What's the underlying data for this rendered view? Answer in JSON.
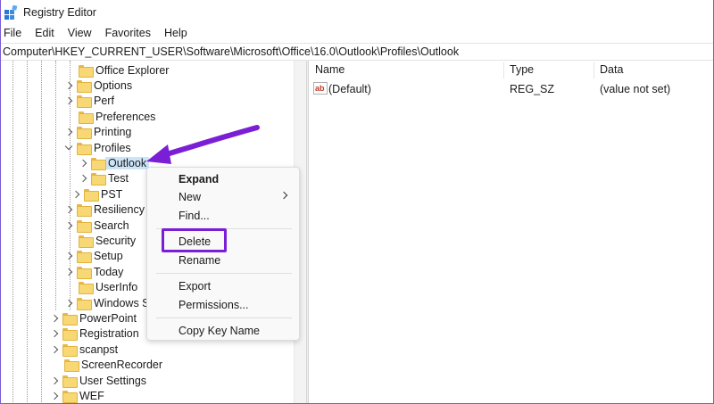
{
  "window": {
    "title": "Registry Editor"
  },
  "menu": [
    "File",
    "Edit",
    "View",
    "Favorites",
    "Help"
  ],
  "address": "Computer\\HKEY_CURRENT_USER\\Software\\Microsoft\\Office\\16.0\\Outlook\\Profiles\\Outlook",
  "tree": {
    "rows": [
      {
        "label": "Office Explorer",
        "expander": "none"
      },
      {
        "label": "Options",
        "expander": "collapsed"
      },
      {
        "label": "Perf",
        "expander": "collapsed"
      },
      {
        "label": "Preferences",
        "expander": "none"
      },
      {
        "label": "Printing",
        "expander": "collapsed"
      },
      {
        "label": "Profiles",
        "expander": "expanded"
      },
      {
        "label": "Outlook",
        "expander": "collapsed",
        "selected": true
      },
      {
        "label": "Test",
        "expander": "collapsed"
      },
      {
        "label": "PST",
        "expander": "collapsed"
      },
      {
        "label": "Resiliency",
        "expander": "collapsed"
      },
      {
        "label": "Search",
        "expander": "collapsed"
      },
      {
        "label": "Security",
        "expander": "none"
      },
      {
        "label": "Setup",
        "expander": "collapsed"
      },
      {
        "label": "Today",
        "expander": "collapsed"
      },
      {
        "label": "UserInfo",
        "expander": "none"
      },
      {
        "label": "Windows S",
        "expander": "collapsed"
      },
      {
        "label": "PowerPoint",
        "expander": "collapsed"
      },
      {
        "label": "Registration",
        "expander": "collapsed"
      },
      {
        "label": "scanpst",
        "expander": "collapsed"
      },
      {
        "label": "ScreenRecorder",
        "expander": "none"
      },
      {
        "label": "User Settings",
        "expander": "collapsed"
      },
      {
        "label": "WEF",
        "expander": "collapsed"
      }
    ]
  },
  "list": {
    "columns": [
      "Name",
      "Type",
      "Data"
    ],
    "rows": [
      {
        "name": "(Default)",
        "type": "REG_SZ",
        "data": "(value not set)",
        "icon": "string-value-icon"
      }
    ]
  },
  "context_menu": {
    "items": [
      "Expand",
      "New",
      "Find...",
      "Delete",
      "Rename",
      "Export",
      "Permissions...",
      "Copy Key Name"
    ]
  },
  "colors": {
    "annotation": "#7b1fd6",
    "selection": "#cce4f7",
    "folder": "#f8d775"
  }
}
